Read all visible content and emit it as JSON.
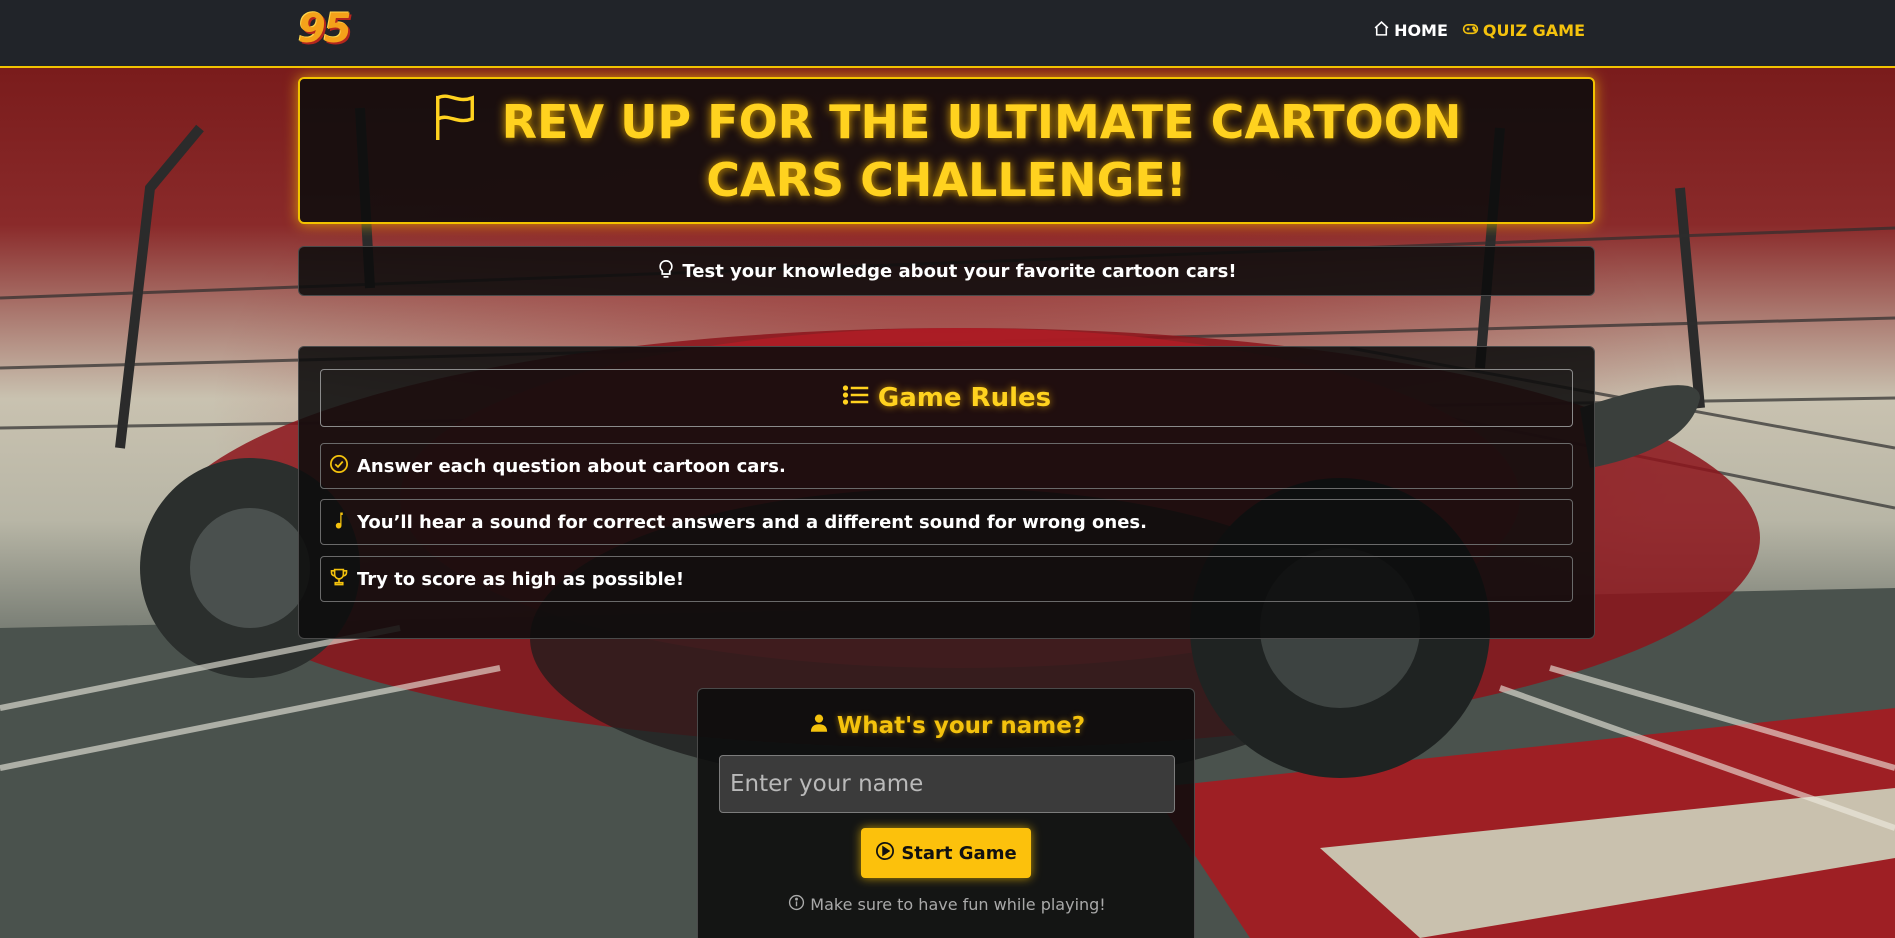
{
  "navbar": {
    "logo": "95",
    "links": [
      {
        "label": "HOME",
        "icon": "house-icon"
      },
      {
        "label": "QUIZ GAME",
        "icon": "gamepad-icon"
      }
    ]
  },
  "hero": {
    "title": "REV UP FOR THE ULTIMATE CARTOON CARS CHALLENGE!",
    "icon": "flag-icon"
  },
  "subtitle": {
    "text": "Test your knowledge about your favorite cartoon cars!",
    "icon": "lightbulb-icon"
  },
  "rules": {
    "heading": "Game Rules",
    "heading_icon": "list-icon",
    "items": [
      {
        "text": "Answer each question about cartoon cars.",
        "icon": "check-circle-icon"
      },
      {
        "text": "You’ll hear a sound for correct answers and a different sound for wrong ones.",
        "icon": "music-note-icon"
      },
      {
        "text": "Try to score as high as possible!",
        "icon": "trophy-icon"
      }
    ]
  },
  "player": {
    "label": "What's your name?",
    "label_icon": "person-icon",
    "input_placeholder": "Enter your name",
    "input_value": "",
    "start_label": "Start Game",
    "start_icon": "play-circle-icon",
    "hint": "Make sure to have fun while playing!",
    "hint_icon": "info-circle-icon"
  },
  "colors": {
    "accent": "#f4c20d",
    "navbar_bg": "#212429",
    "panel_bg": "#0c0c0c",
    "button_bg": "#fcc10c"
  }
}
